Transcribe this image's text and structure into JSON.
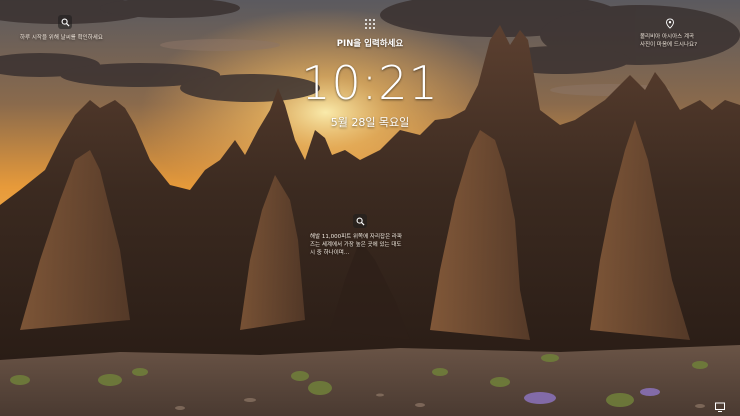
{
  "lock_screen": {
    "tip_text": "하루 시작을 위해 날씨를 확인하세요",
    "keypad_icon": "keypad-icon",
    "pin_prompt": "PIN을 입력하세요",
    "time": "10:21",
    "date": "5월 28일 목요일",
    "info_lines": [
      "볼리비아 아시아스 계곡",
      "사진이 마음에 드시나요?"
    ],
    "center_lines": [
      "해발 11,000피트 위쪽에 자리잡은 라파",
      "즈는 세계에서 가장 높은 곳에 있는 대도",
      "시 중 하나이며…"
    ],
    "icons": [
      "search-icon",
      "location-pin-icon",
      "monitor-icon"
    ]
  }
}
